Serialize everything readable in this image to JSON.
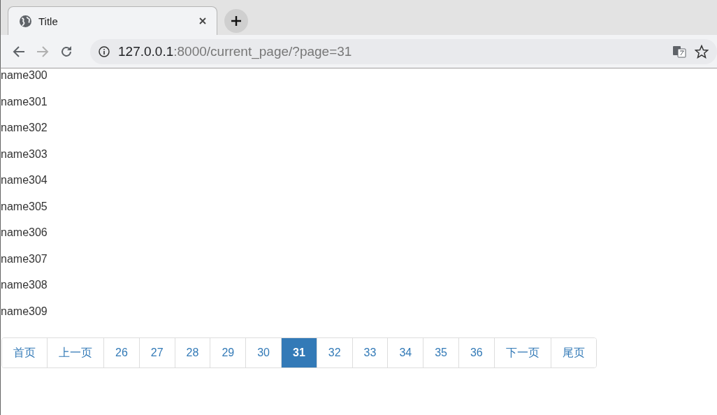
{
  "browser": {
    "tab": {
      "title": "Title"
    },
    "address": {
      "host": "127.0.0.1",
      "path": ":8000/current_page/?page=31"
    }
  },
  "names": [
    "name300",
    "name301",
    "name302",
    "name303",
    "name304",
    "name305",
    "name306",
    "name307",
    "name308",
    "name309"
  ],
  "pagination": [
    {
      "label": "首页",
      "selected": false
    },
    {
      "label": "上一页",
      "selected": false
    },
    {
      "label": "26",
      "selected": false
    },
    {
      "label": "27",
      "selected": false
    },
    {
      "label": "28",
      "selected": false
    },
    {
      "label": "29",
      "selected": false
    },
    {
      "label": "30",
      "selected": false
    },
    {
      "label": "31",
      "selected": true
    },
    {
      "label": "32",
      "selected": false
    },
    {
      "label": "33",
      "selected": false
    },
    {
      "label": "34",
      "selected": false
    },
    {
      "label": "35",
      "selected": false
    },
    {
      "label": "36",
      "selected": false
    },
    {
      "label": "下一页",
      "selected": false
    },
    {
      "label": "尾页",
      "selected": false
    }
  ]
}
